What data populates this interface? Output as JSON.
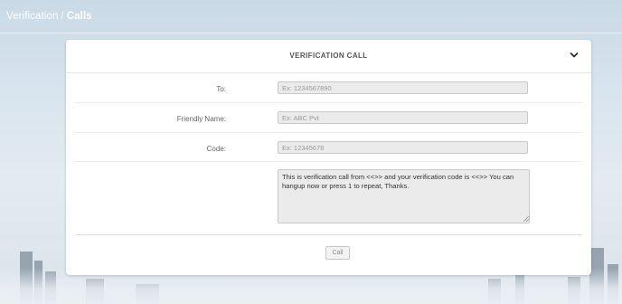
{
  "breadcrumb": {
    "parent": "Verification",
    "separator": "/",
    "current": "Calls"
  },
  "card": {
    "title": "VERIFICATION CALL"
  },
  "form": {
    "to": {
      "label": "To:",
      "placeholder": "Ex: 1234567890"
    },
    "friendly_name": {
      "label": "Friendly Name:",
      "placeholder": "Ex: ABC Pvt"
    },
    "code": {
      "label": "Code:",
      "placeholder": "Ex: 12345678"
    },
    "message": {
      "value": "This is verification call from <<>> and your verification code is <<>> You can hangup now or press 1 to repeat, Thanks."
    }
  },
  "actions": {
    "call_label": "Call"
  },
  "colors": {
    "card_bg": "#ffffff",
    "input_bg": "#ebebeb",
    "accent_text": "#555555"
  },
  "icons": {
    "collapse": "chevron-down-icon",
    "resize": "resize-grip-icon"
  }
}
